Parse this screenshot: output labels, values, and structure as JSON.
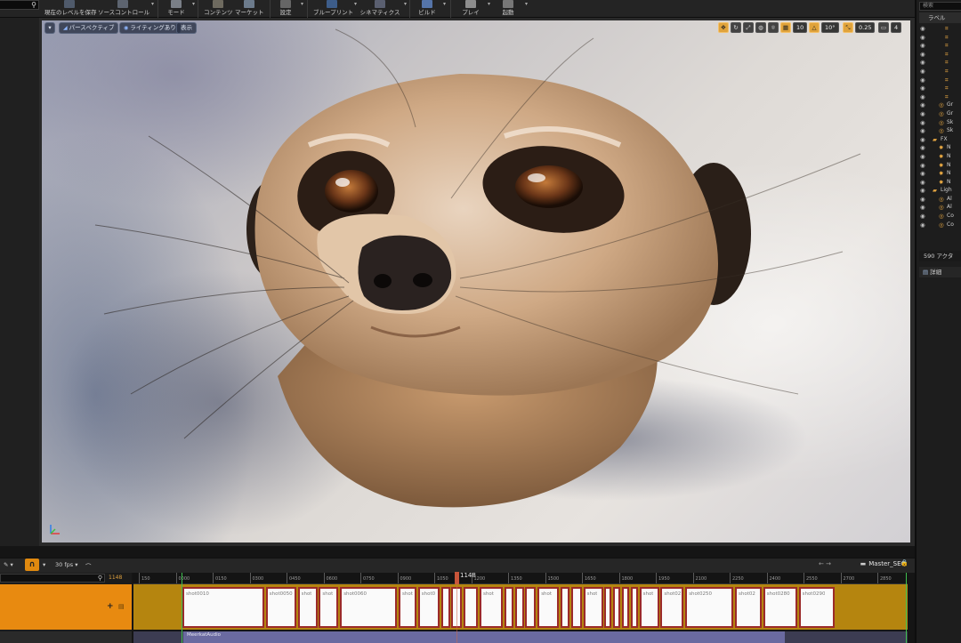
{
  "toolbar": {
    "buttons": [
      {
        "id": "save_level",
        "label": "現在のレベルを保存",
        "icon": "save-icon"
      },
      {
        "id": "source_control",
        "label": "ソースコントロール",
        "icon": "source-control-icon"
      },
      {
        "id": "modes",
        "label": "モード",
        "icon": "modes-icon"
      },
      {
        "id": "content",
        "label": "コンテンツ",
        "icon": "content-icon"
      },
      {
        "id": "marketplace",
        "label": "マーケット",
        "icon": "marketplace-icon"
      },
      {
        "id": "settings",
        "label": "設定",
        "icon": "settings-icon"
      },
      {
        "id": "blueprints",
        "label": "ブループリント",
        "icon": "blueprint-icon"
      },
      {
        "id": "cinematics",
        "label": "シネマティクス",
        "icon": "cinematics-icon"
      },
      {
        "id": "build",
        "label": "ビルド",
        "icon": "build-icon"
      },
      {
        "id": "play",
        "label": "プレイ",
        "icon": "play-icon"
      },
      {
        "id": "launch",
        "label": "起動",
        "icon": "launch-icon"
      }
    ]
  },
  "viewport": {
    "menu_caret": "▾",
    "view_mode": "パースペクティブ",
    "lighting": "ライティングあり",
    "show": "表示",
    "grid_snap_value": "10",
    "rotation_snap_value": "10°",
    "scale_snap_value": "0.25",
    "camera_speed": "4"
  },
  "outliner": {
    "search_placeholder": "検索",
    "header_label": "ラベル",
    "rows": [
      {
        "name": "",
        "indent": 2,
        "icon": "actor-icon"
      },
      {
        "name": "",
        "indent": 2,
        "icon": "actor-icon"
      },
      {
        "name": "",
        "indent": 2,
        "icon": "actor-icon"
      },
      {
        "name": "",
        "indent": 2,
        "icon": "actor-icon"
      },
      {
        "name": "",
        "indent": 2,
        "icon": "actor-icon"
      },
      {
        "name": "",
        "indent": 2,
        "icon": "actor-icon"
      },
      {
        "name": "",
        "indent": 2,
        "icon": "actor-icon"
      },
      {
        "name": "",
        "indent": 2,
        "icon": "actor-icon"
      },
      {
        "name": "",
        "indent": 2,
        "icon": "actor-icon"
      },
      {
        "name": "Gr",
        "indent": 1,
        "icon": "light-icon"
      },
      {
        "name": "Gr",
        "indent": 1,
        "icon": "light-icon"
      },
      {
        "name": "Sk",
        "indent": 1,
        "icon": "light-icon"
      },
      {
        "name": "Sk",
        "indent": 1,
        "icon": "light-icon"
      },
      {
        "name": "FX",
        "indent": 0,
        "icon": "folder-icon"
      },
      {
        "name": "N",
        "indent": 1,
        "icon": "niagara-icon"
      },
      {
        "name": "N",
        "indent": 1,
        "icon": "niagara-icon"
      },
      {
        "name": "N",
        "indent": 1,
        "icon": "niagara-icon"
      },
      {
        "name": "N",
        "indent": 1,
        "icon": "niagara-icon"
      },
      {
        "name": "N",
        "indent": 1,
        "icon": "niagara-icon"
      },
      {
        "name": "Ligh",
        "indent": 0,
        "icon": "folder-icon"
      },
      {
        "name": "Al",
        "indent": 1,
        "icon": "light-icon"
      },
      {
        "name": "Al",
        "indent": 1,
        "icon": "light-icon"
      },
      {
        "name": "Co",
        "indent": 1,
        "icon": "light-icon"
      },
      {
        "name": "Co",
        "indent": 1,
        "icon": "light-icon"
      }
    ],
    "actor_count": "590 アクタ",
    "details_tab": "詳細"
  },
  "sequencer": {
    "fps": "30 fps",
    "sequence_name": "Master_SEQ",
    "current_frame": "1148",
    "left_frame_label": "1148",
    "ruler_ticks": [
      "150",
      "0000",
      "0150",
      "0300",
      "0450",
      "0600",
      "0750",
      "0900",
      "1050",
      "1200",
      "1350",
      "1500",
      "1650",
      "1800",
      "1950",
      "2100",
      "2250",
      "2400",
      "2550",
      "2700",
      "2850"
    ],
    "shots": [
      {
        "name": "shot0010"
      },
      {
        "name": "shot0050"
      },
      {
        "name": "shot"
      },
      {
        "name": "shot"
      },
      {
        "name": "shot0060"
      },
      {
        "name": "shot"
      },
      {
        "name": "shot0"
      },
      {
        "name": ""
      },
      {
        "name": ""
      },
      {
        "name": ""
      },
      {
        "name": "shot"
      },
      {
        "name": ""
      },
      {
        "name": ""
      },
      {
        "name": ""
      },
      {
        "name": "shot"
      },
      {
        "name": ""
      },
      {
        "name": ""
      },
      {
        "name": "shot"
      },
      {
        "name": ""
      },
      {
        "name": ""
      },
      {
        "name": ""
      },
      {
        "name": ""
      },
      {
        "name": "shot"
      },
      {
        "name": "shot02"
      },
      {
        "name": "shot0250"
      },
      {
        "name": "shot02"
      },
      {
        "name": "shot0280"
      },
      {
        "name": "shot0290"
      }
    ],
    "audio_clip": "MeerkatAudio"
  }
}
